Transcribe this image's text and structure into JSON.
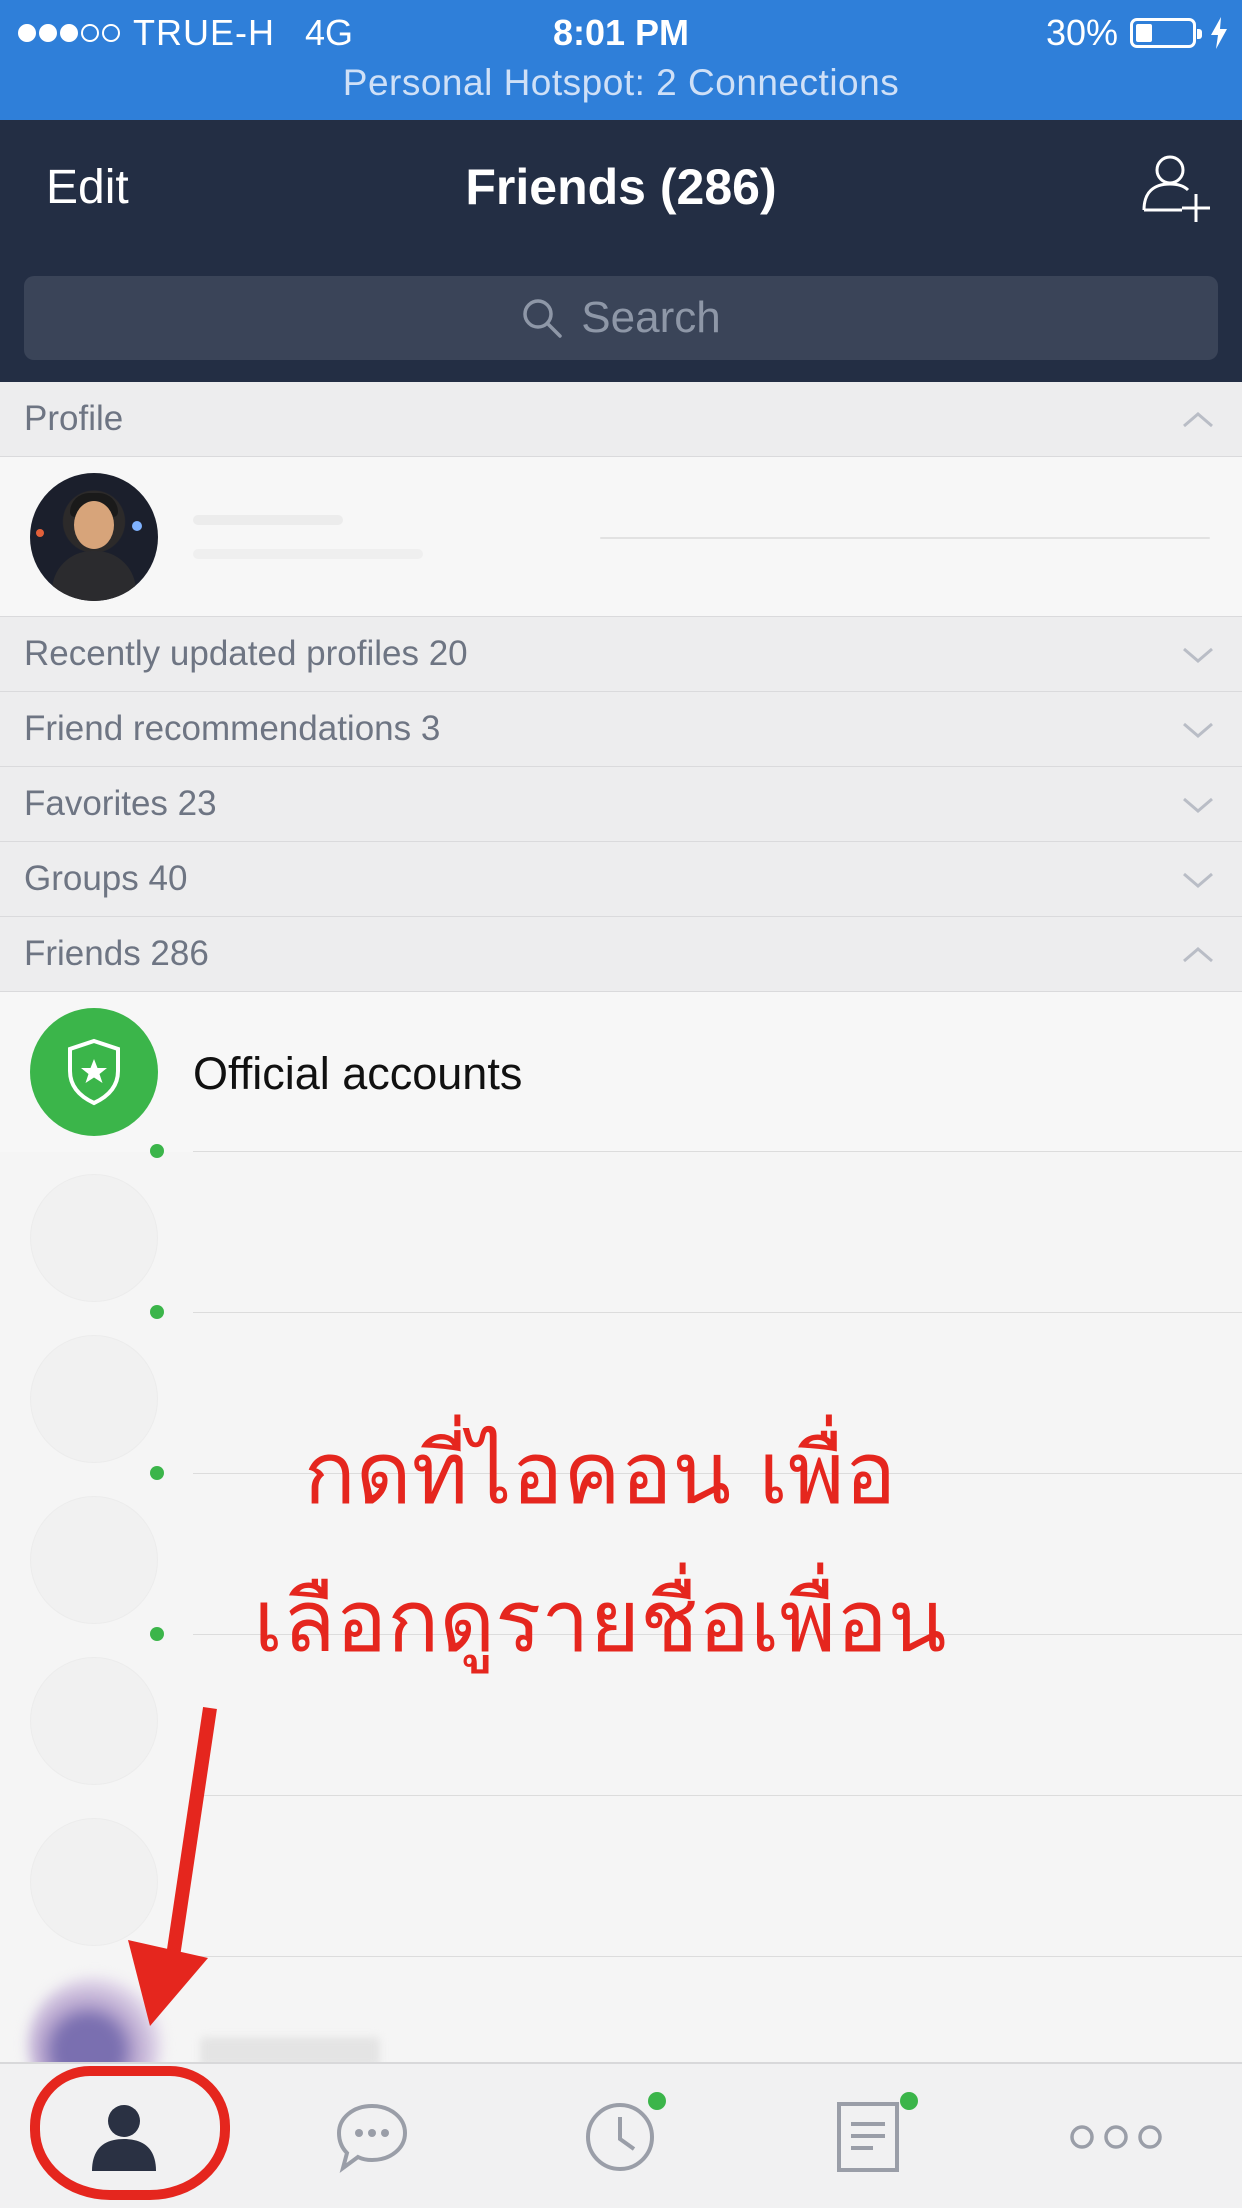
{
  "status_bar": {
    "carrier": "TRUE-H",
    "network": "4G",
    "time": "8:01 PM",
    "battery_percent": "30%",
    "battery_level": 0.3,
    "signal_bars_filled": 3,
    "signal_bars_total": 5,
    "hotspot_text": "Personal Hotspot: 2 Connections"
  },
  "header": {
    "edit_label": "Edit",
    "title": "Friends (286)",
    "add_friend_icon": "add-friend-icon"
  },
  "search": {
    "placeholder": "Search",
    "icon": "search-icon"
  },
  "sections": {
    "profile": "Profile",
    "recently_updated": "Recently updated profiles 20",
    "friend_recommendations": "Friend recommendations 3",
    "favorites": "Favorites 23",
    "groups": "Groups 40",
    "friends": "Friends 286"
  },
  "official_accounts": {
    "label": "Official accounts",
    "icon": "shield-star-icon"
  },
  "annotation": {
    "line1": "กดที่ไอคอน เพื่อ",
    "line2": "เลือกดูรายชื่อเพื่อน",
    "color": "#e5261e"
  },
  "tabbar": {
    "tabs": [
      {
        "icon": "friends-icon",
        "active": true,
        "badge": false
      },
      {
        "icon": "chats-icon",
        "active": false,
        "badge": false
      },
      {
        "icon": "timeline-icon",
        "active": false,
        "badge": true
      },
      {
        "icon": "news-icon",
        "active": false,
        "badge": true
      },
      {
        "icon": "more-icon",
        "active": false,
        "badge": false
      }
    ]
  },
  "colors": {
    "status_bar": "#2f7fd9",
    "nav": "#232e44",
    "accent_green": "#3bb54a"
  }
}
